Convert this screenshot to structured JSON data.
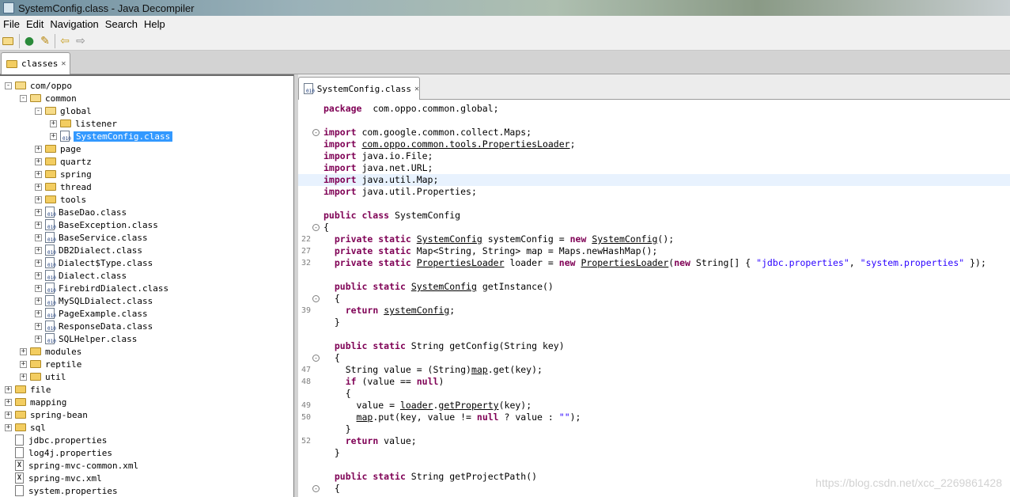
{
  "window": {
    "title": "SystemConfig.class - Java Decompiler"
  },
  "menu": [
    "File",
    "Edit",
    "Navigation",
    "Search",
    "Help"
  ],
  "toolbar": {
    "icons": [
      "open-folder-icon",
      "open-type-icon",
      "search-icon",
      "back-arrow-icon",
      "forward-arrow-icon"
    ]
  },
  "outer_tab": {
    "label": "classes"
  },
  "tree": [
    {
      "indent": 0,
      "exp": "-",
      "icon": "folder-open",
      "label": "com/oppo"
    },
    {
      "indent": 1,
      "exp": "-",
      "icon": "folder-open",
      "label": "common"
    },
    {
      "indent": 2,
      "exp": "-",
      "icon": "folder-open",
      "label": "global"
    },
    {
      "indent": 3,
      "exp": "+",
      "icon": "folder",
      "label": "listener"
    },
    {
      "indent": 3,
      "exp": "+",
      "icon": "class",
      "label": "SystemConfig.class",
      "selected": true
    },
    {
      "indent": 2,
      "exp": "+",
      "icon": "folder",
      "label": "page"
    },
    {
      "indent": 2,
      "exp": "+",
      "icon": "folder",
      "label": "quartz"
    },
    {
      "indent": 2,
      "exp": "+",
      "icon": "folder",
      "label": "spring"
    },
    {
      "indent": 2,
      "exp": "+",
      "icon": "folder",
      "label": "thread"
    },
    {
      "indent": 2,
      "exp": "+",
      "icon": "folder",
      "label": "tools"
    },
    {
      "indent": 2,
      "exp": "+",
      "icon": "class",
      "label": "BaseDao.class"
    },
    {
      "indent": 2,
      "exp": "+",
      "icon": "class",
      "label": "BaseException.class"
    },
    {
      "indent": 2,
      "exp": "+",
      "icon": "class",
      "label": "BaseService.class"
    },
    {
      "indent": 2,
      "exp": "+",
      "icon": "class",
      "label": "DB2Dialect.class"
    },
    {
      "indent": 2,
      "exp": "+",
      "icon": "class",
      "label": "Dialect$Type.class"
    },
    {
      "indent": 2,
      "exp": "+",
      "icon": "class",
      "label": "Dialect.class"
    },
    {
      "indent": 2,
      "exp": "+",
      "icon": "class",
      "label": "FirebirdDialect.class"
    },
    {
      "indent": 2,
      "exp": "+",
      "icon": "class",
      "label": "MySQLDialect.class"
    },
    {
      "indent": 2,
      "exp": "+",
      "icon": "class",
      "label": "PageExample.class"
    },
    {
      "indent": 2,
      "exp": "+",
      "icon": "class",
      "label": "ResponseData.class"
    },
    {
      "indent": 2,
      "exp": "+",
      "icon": "class",
      "label": "SQLHelper.class"
    },
    {
      "indent": 1,
      "exp": "+",
      "icon": "folder",
      "label": "modules"
    },
    {
      "indent": 1,
      "exp": "+",
      "icon": "folder",
      "label": "reptile"
    },
    {
      "indent": 1,
      "exp": "+",
      "icon": "folder",
      "label": "util"
    },
    {
      "indent": 0,
      "exp": "+",
      "icon": "folder",
      "label": "file"
    },
    {
      "indent": 0,
      "exp": "+",
      "icon": "folder",
      "label": "mapping"
    },
    {
      "indent": 0,
      "exp": "+",
      "icon": "folder",
      "label": "spring-bean"
    },
    {
      "indent": 0,
      "exp": "+",
      "icon": "folder",
      "label": "sql"
    },
    {
      "indent": 0,
      "exp": "",
      "icon": "prop",
      "label": "jdbc.properties"
    },
    {
      "indent": 0,
      "exp": "",
      "icon": "prop",
      "label": "log4j.properties"
    },
    {
      "indent": 0,
      "exp": "",
      "icon": "xml",
      "label": "spring-mvc-common.xml"
    },
    {
      "indent": 0,
      "exp": "",
      "icon": "xml",
      "label": "spring-mvc.xml"
    },
    {
      "indent": 0,
      "exp": "",
      "icon": "prop",
      "label": "system.properties"
    }
  ],
  "editor_tab": {
    "label": "SystemConfig.class"
  },
  "code": [
    {
      "num": "",
      "fold": false,
      "tokens": [
        [
          "kw",
          "package"
        ],
        [
          "",
          "  com.oppo.common.global;"
        ]
      ]
    },
    {
      "num": "",
      "fold": false,
      "tokens": []
    },
    {
      "num": "",
      "fold": true,
      "tokens": [
        [
          "kw",
          "import"
        ],
        [
          "",
          " com.google.common.collect.Maps;"
        ]
      ]
    },
    {
      "num": "",
      "fold": false,
      "tokens": [
        [
          "kw",
          "import"
        ],
        [
          "",
          " "
        ],
        [
          "ul",
          "com.oppo.common.tools.PropertiesLoader"
        ],
        [
          "",
          ";"
        ]
      ]
    },
    {
      "num": "",
      "fold": false,
      "tokens": [
        [
          "kw",
          "import"
        ],
        [
          "",
          " java.io.File;"
        ]
      ]
    },
    {
      "num": "",
      "fold": false,
      "tokens": [
        [
          "kw",
          "import"
        ],
        [
          "",
          " java.net.URL;"
        ]
      ]
    },
    {
      "num": "",
      "fold": false,
      "hl": true,
      "tokens": [
        [
          "kw",
          "import"
        ],
        [
          "",
          " java.util.Map;"
        ]
      ]
    },
    {
      "num": "",
      "fold": false,
      "tokens": [
        [
          "kw",
          "import"
        ],
        [
          "",
          " java.util.Properties;"
        ]
      ]
    },
    {
      "num": "",
      "fold": false,
      "tokens": []
    },
    {
      "num": "",
      "fold": false,
      "tokens": [
        [
          "kw",
          "public class"
        ],
        [
          "",
          " SystemConfig"
        ]
      ]
    },
    {
      "num": "",
      "fold": true,
      "tokens": [
        [
          "",
          "{"
        ]
      ]
    },
    {
      "num": "22",
      "fold": false,
      "tokens": [
        [
          "",
          "  "
        ],
        [
          "kw",
          "private static"
        ],
        [
          "",
          " "
        ],
        [
          "ul",
          "SystemConfig"
        ],
        [
          "",
          " systemConfig = "
        ],
        [
          "kw",
          "new"
        ],
        [
          "",
          " "
        ],
        [
          "ul",
          "SystemConfig"
        ],
        [
          "",
          "();"
        ]
      ]
    },
    {
      "num": "27",
      "fold": false,
      "tokens": [
        [
          "",
          "  "
        ],
        [
          "kw",
          "private static"
        ],
        [
          "",
          " Map<String, String> map = Maps.newHashMap();"
        ]
      ]
    },
    {
      "num": "32",
      "fold": false,
      "tokens": [
        [
          "",
          "  "
        ],
        [
          "kw",
          "private static"
        ],
        [
          "",
          " "
        ],
        [
          "ul",
          "PropertiesLoader"
        ],
        [
          "",
          " loader = "
        ],
        [
          "kw",
          "new"
        ],
        [
          "",
          " "
        ],
        [
          "ul",
          "PropertiesLoader"
        ],
        [
          "",
          "("
        ],
        [
          "kw",
          "new"
        ],
        [
          "",
          " String[] { "
        ],
        [
          "str",
          "\"jdbc.properties\""
        ],
        [
          "",
          ", "
        ],
        [
          "str",
          "\"system.properties\""
        ],
        [
          "",
          " });"
        ]
      ]
    },
    {
      "num": "",
      "fold": false,
      "tokens": []
    },
    {
      "num": "",
      "fold": false,
      "tokens": [
        [
          "",
          "  "
        ],
        [
          "kw",
          "public static"
        ],
        [
          "",
          " "
        ],
        [
          "ul",
          "SystemConfig"
        ],
        [
          "",
          " getInstance()"
        ]
      ]
    },
    {
      "num": "",
      "fold": true,
      "tokens": [
        [
          "",
          "  {"
        ]
      ]
    },
    {
      "num": "39",
      "fold": false,
      "tokens": [
        [
          "",
          "    "
        ],
        [
          "kw",
          "return"
        ],
        [
          "",
          " "
        ],
        [
          "ul",
          "systemConfig"
        ],
        [
          "",
          ";"
        ]
      ]
    },
    {
      "num": "",
      "fold": false,
      "tokens": [
        [
          "",
          "  }"
        ]
      ]
    },
    {
      "num": "",
      "fold": false,
      "tokens": []
    },
    {
      "num": "",
      "fold": false,
      "tokens": [
        [
          "",
          "  "
        ],
        [
          "kw",
          "public static"
        ],
        [
          "",
          " String getConfig(String key)"
        ]
      ]
    },
    {
      "num": "",
      "fold": true,
      "tokens": [
        [
          "",
          "  {"
        ]
      ]
    },
    {
      "num": "47",
      "fold": false,
      "tokens": [
        [
          "",
          "    String value = (String)"
        ],
        [
          "ul",
          "map"
        ],
        [
          "",
          ".get(key);"
        ]
      ]
    },
    {
      "num": "48",
      "fold": false,
      "tokens": [
        [
          "",
          "    "
        ],
        [
          "kw",
          "if"
        ],
        [
          "",
          " (value == "
        ],
        [
          "kw",
          "null"
        ],
        [
          "",
          ")"
        ]
      ]
    },
    {
      "num": "",
      "fold": false,
      "tokens": [
        [
          "",
          "    {"
        ]
      ]
    },
    {
      "num": "49",
      "fold": false,
      "tokens": [
        [
          "",
          "      value = "
        ],
        [
          "ul",
          "loader"
        ],
        [
          "",
          "."
        ],
        [
          "ul",
          "getProperty"
        ],
        [
          "",
          "(key);"
        ]
      ]
    },
    {
      "num": "50",
      "fold": false,
      "tokens": [
        [
          "",
          "      "
        ],
        [
          "ul",
          "map"
        ],
        [
          "",
          ".put(key, value != "
        ],
        [
          "kw",
          "null"
        ],
        [
          "",
          " ? value : "
        ],
        [
          "str",
          "\"\""
        ],
        [
          "",
          ");"
        ]
      ]
    },
    {
      "num": "",
      "fold": false,
      "tokens": [
        [
          "",
          "    }"
        ]
      ]
    },
    {
      "num": "52",
      "fold": false,
      "tokens": [
        [
          "",
          "    "
        ],
        [
          "kw",
          "return"
        ],
        [
          "",
          " value;"
        ]
      ]
    },
    {
      "num": "",
      "fold": false,
      "tokens": [
        [
          "",
          "  }"
        ]
      ]
    },
    {
      "num": "",
      "fold": false,
      "tokens": []
    },
    {
      "num": "",
      "fold": false,
      "tokens": [
        [
          "",
          "  "
        ],
        [
          "kw",
          "public static"
        ],
        [
          "",
          " String getProjectPath()"
        ]
      ]
    },
    {
      "num": "",
      "fold": true,
      "tokens": [
        [
          "",
          "  {"
        ]
      ]
    }
  ],
  "watermark": "https://blog.csdn.net/xcc_2269861428"
}
